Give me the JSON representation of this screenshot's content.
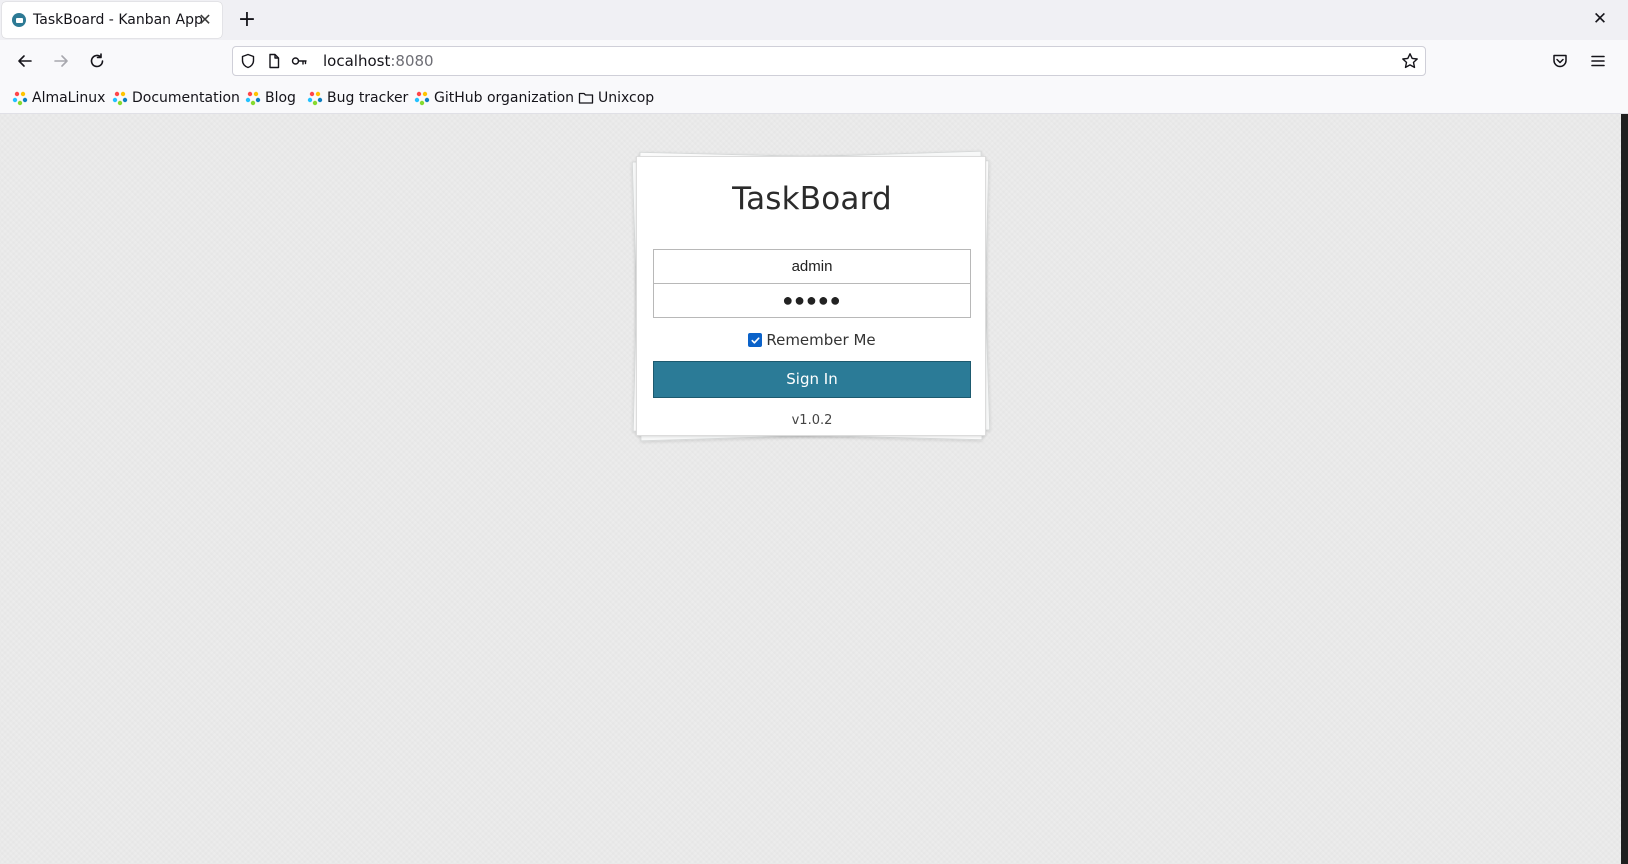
{
  "browser": {
    "tab": {
      "title": "TaskBoard - Kanban App",
      "close_glyph": "✕",
      "favicon": "taskboard-favicon"
    },
    "new_tab_glyph": "+",
    "window_close_glyph": "✕",
    "url": {
      "host": "localhost",
      "port": ":8080"
    },
    "bookmarks": [
      {
        "label": "AlmaLinux",
        "icon": "almalinux-icon"
      },
      {
        "label": "Documentation",
        "icon": "almalinux-icon"
      },
      {
        "label": "Blog",
        "icon": "almalinux-icon"
      },
      {
        "label": "Bug tracker",
        "icon": "almalinux-icon"
      },
      {
        "label": "GitHub organization",
        "icon": "almalinux-icon"
      },
      {
        "label": "Unixcop",
        "icon": "folder-icon"
      }
    ]
  },
  "login": {
    "title": "TaskBoard",
    "username_value": "admin",
    "password_value": "●●●●●",
    "remember_checked": true,
    "remember_label": "Remember Me",
    "signin_label": "Sign In",
    "version": "v1.0.2"
  },
  "colors": {
    "accent": "#2b7b97",
    "checkbox": "#0b62c9",
    "page_background": "#ececec"
  }
}
